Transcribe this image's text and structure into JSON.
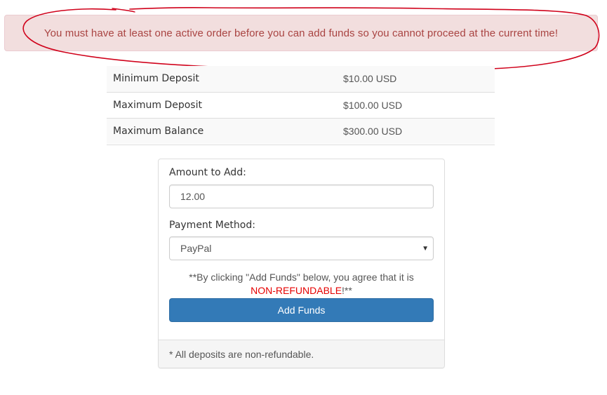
{
  "alert": {
    "message": "You must have at least one active order before you can add funds so you cannot proceed at the current time!"
  },
  "limits": [
    {
      "label": "Minimum Deposit",
      "value": "$10.00 USD"
    },
    {
      "label": "Maximum Deposit",
      "value": "$100.00 USD"
    },
    {
      "label": "Maximum Balance",
      "value": "$300.00 USD"
    }
  ],
  "form": {
    "amount_label": "Amount to Add:",
    "amount_value": "12.00",
    "payment_label": "Payment Method:",
    "payment_value": "PayPal",
    "notice_prefix": "**By clicking \"Add Funds\" below, you agree that it is",
    "notice_nonrefundable": "NON-REFUNDABLE",
    "notice_suffix": "!**",
    "submit_label": "Add Funds",
    "footer_note": "* All deposits are non-refundable."
  },
  "colors": {
    "alert_bg": "#f2dede",
    "alert_text": "#a94442",
    "annotation": "#d0021b",
    "primary_button": "#337ab7",
    "nonrefundable_text": "#e60000"
  },
  "icons": {
    "select_arrow": "caret-down-icon"
  }
}
